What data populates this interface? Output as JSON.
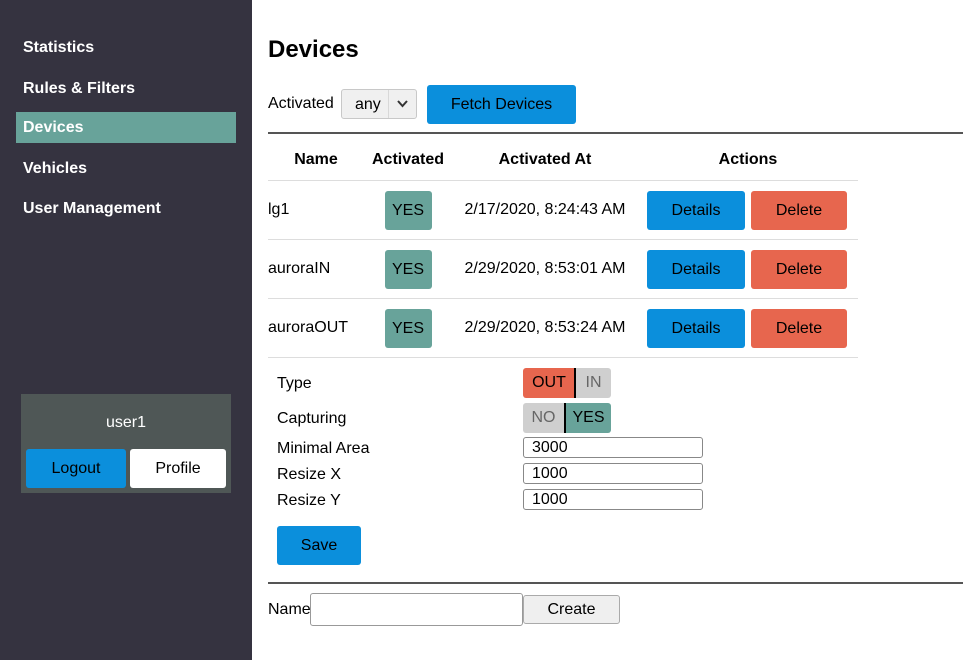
{
  "sidebar": {
    "items": [
      {
        "label": "Statistics"
      },
      {
        "label": "Rules & Filters"
      },
      {
        "label": "Devices"
      },
      {
        "label": "Vehicles"
      },
      {
        "label": "User Management"
      }
    ],
    "active": "Devices",
    "user": {
      "name": "user1",
      "logout_label": "Logout",
      "profile_label": "Profile"
    }
  },
  "main": {
    "title": "Devices",
    "filter": {
      "label": "Activated",
      "selected": "any",
      "fetch_label": "Fetch Devices"
    },
    "table": {
      "headers": [
        "Name",
        "Activated",
        "Activated At",
        "Actions"
      ],
      "rows": [
        {
          "name": "lg1",
          "activated": "YES",
          "activated_at": "2/17/2020, 8:24:43 AM",
          "details": "Details",
          "delete": "Delete"
        },
        {
          "name": "auroraIN",
          "activated": "YES",
          "activated_at": "2/29/2020, 8:53:01 AM",
          "details": "Details",
          "delete": "Delete"
        },
        {
          "name": "auroraOUT",
          "activated": "YES",
          "activated_at": "2/29/2020, 8:53:24 AM",
          "details": "Details",
          "delete": "Delete"
        }
      ]
    },
    "form": {
      "type": {
        "label": "Type",
        "options": [
          "OUT",
          "IN"
        ],
        "selected": "OUT"
      },
      "capturing": {
        "label": "Capturing",
        "options": [
          "NO",
          "YES"
        ],
        "selected": "YES"
      },
      "minimal_area": {
        "label": "Minimal Area",
        "value": "3000"
      },
      "resize_x": {
        "label": "Resize X",
        "value": "1000"
      },
      "resize_y": {
        "label": "Resize Y",
        "value": "1000"
      },
      "save_label": "Save"
    },
    "create": {
      "label": "Name",
      "value": "",
      "button_label": "Create"
    }
  },
  "colors": {
    "sidebar_bg": "#353340",
    "accent_green": "#68a39a",
    "primary_blue": "#0b8fdc",
    "danger_red": "#e7664e",
    "user_box_bg": "#4f5756"
  }
}
